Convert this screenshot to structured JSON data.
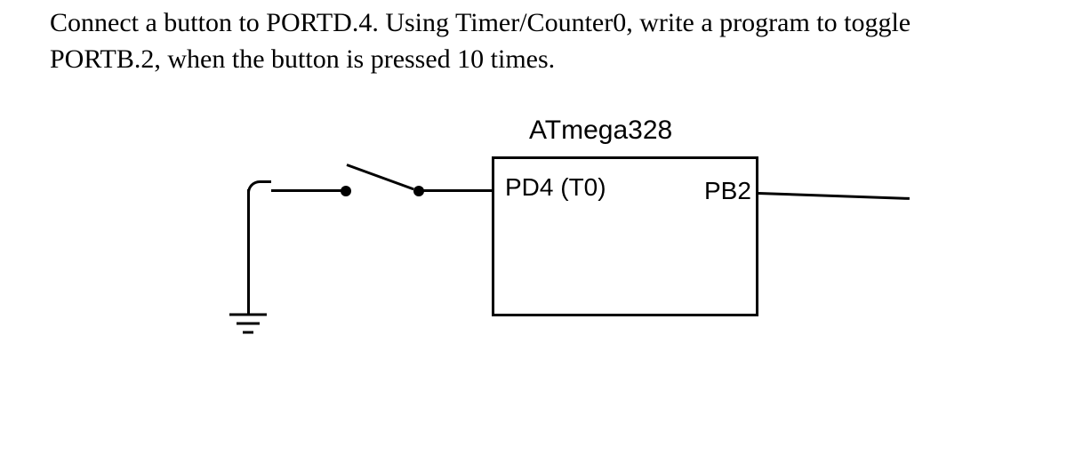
{
  "question": "Connect a button to PORTD.4. Using Timer/Counter0, write a program to toggle PORTB.2, when the button is pressed 10 times.",
  "chip": {
    "title": "ATmega328",
    "left_pin": "PD4 (T0)",
    "right_pin": "PB2"
  },
  "components": {
    "button_pin": "PORTD.4",
    "output_pin": "PORTB.2",
    "timer": "Timer/Counter0",
    "press_count": 10
  }
}
